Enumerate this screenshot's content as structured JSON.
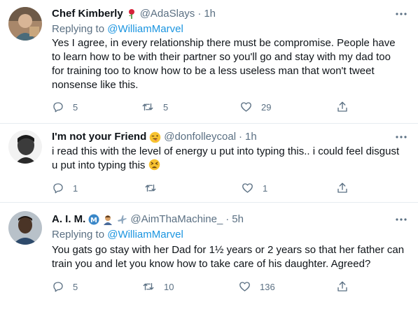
{
  "tweets": [
    {
      "name": "Chef Kimberly",
      "name_emoji": "rose-emoji",
      "handle": "@AdaSlays",
      "dot": "·",
      "time": "1h",
      "replying_prefix": "Replying to",
      "replying_to": "@WilliamMarvel",
      "text": "Yes I agree, in every relationship there must be compromise. People have to learn how to be with their partner so you'll go and stay with my dad too for training too to know how to be a less useless man that won't tweet nonsense like this.",
      "replies": "5",
      "retweets": "5",
      "likes": "29"
    },
    {
      "name": "I'm not your Friend",
      "name_emoji": "winking-tongue-face-emoji",
      "handle": "@donfolleycoal",
      "dot": "·",
      "time": "1h",
      "text_lines": [
        "i read this with the level of energy u put into typing this.. i could feel disgust",
        "u put into typing this"
      ],
      "text_emoji": "tired-face-emoji",
      "replies": "1",
      "retweets": "",
      "likes": "1"
    },
    {
      "name": "A. I. M.",
      "name_emojis": [
        "circled-m-emoji",
        "man-emoji",
        "airplane-emoji"
      ],
      "handle": "@AimThaMachine_",
      "dot": "·",
      "time": "5h",
      "replying_prefix": "Replying to",
      "replying_to": "@WilliamMarvel",
      "text": "You gats go stay with her Dad for 1½ years or 2 years so that her father can train you and let you know how to take care of his daughter. Agreed?",
      "replies": "5",
      "retweets": "10",
      "likes": "136"
    }
  ],
  "colors": {
    "text": "#0f1419",
    "secondary": "#5b7083",
    "link": "#1b95e0",
    "divider": "#e6ecf0"
  }
}
